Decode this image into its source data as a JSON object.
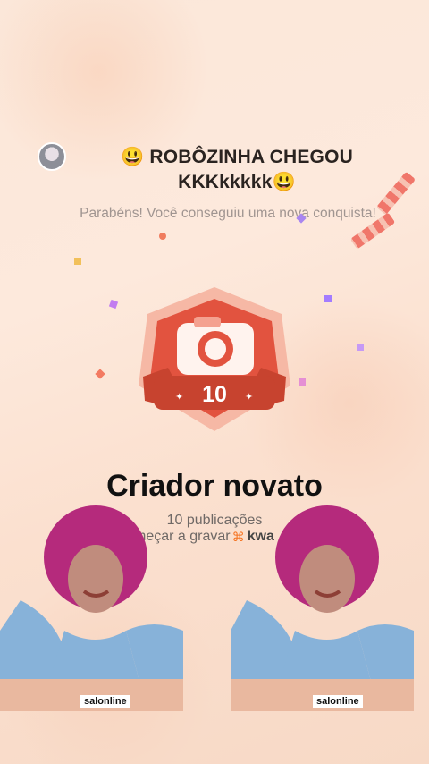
{
  "header": {
    "title": "😃 ROBÔZINHA CHEGOU KKKkkkkk😃",
    "subtitle": "Parabéns! Você conseguiu uma nova conquista!"
  },
  "badge": {
    "number": "10",
    "accent": "#e8533f"
  },
  "achievement": {
    "name": "Criador novato",
    "count": "10 publicações",
    "cta_text": "meçar a gravar",
    "brand": "kwa"
  },
  "watermark": {
    "left_logo": "salonline",
    "right_logo": "salonline"
  }
}
